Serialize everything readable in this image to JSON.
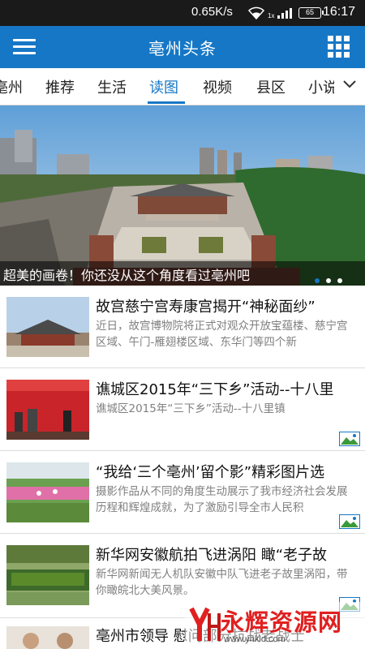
{
  "status_bar": {
    "speed": "0.65K/s",
    "battery": "65",
    "time": "16:17"
  },
  "app_bar": {
    "title": "亳州头条",
    "color": "#1677c6"
  },
  "tabs": [
    {
      "label": "亳州",
      "active": false
    },
    {
      "label": "推荐",
      "active": false
    },
    {
      "label": "生活",
      "active": false
    },
    {
      "label": "读图",
      "active": true
    },
    {
      "label": "视频",
      "active": false
    },
    {
      "label": "县区",
      "active": false
    },
    {
      "label": "小说",
      "active": false
    }
  ],
  "hero": {
    "caption": "超美的画卷！你还没从这个角度看过亳州吧"
  },
  "news": [
    {
      "title": "故宫慈宁宫寿康宫揭开“神秘面纱”",
      "desc": "近日，故宫博物院将正式对观众开放宝蕴楼、慈宁宫区域、午门-雁翅楼区域、东华门等四个新"
    },
    {
      "title": "谯城区2015年“三下乡”活动--十八里",
      "desc": "谯城区2015年“三下乡”活动--十八里镇"
    },
    {
      "title": "“我给‘三个亳州’留个影”精彩图片选",
      "desc": "摄影作品从不同的角度生动展示了我市经济社会发展历程和辉煌成就，为了激励引导全市人民积"
    },
    {
      "title": "新华网安徽航拍飞进涡阳 瞰“老子故",
      "desc": "新华网新闻无人机队安徽中队飞进老子故里涡阳，带你瞰皖北大美风景。"
    },
    {
      "title": "亳州市领导 慰问部分抗战老战士",
      "desc": ""
    }
  ],
  "watermark": {
    "brand": "永辉资源网",
    "url": "www.yhkld.com"
  }
}
